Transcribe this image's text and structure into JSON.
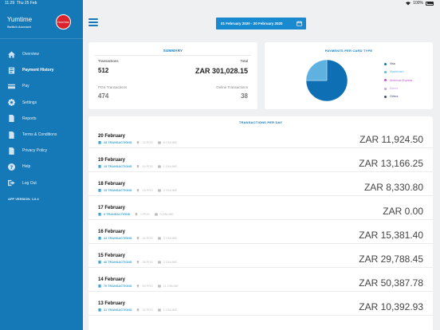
{
  "status_bar": {
    "time": "11:29",
    "date": "Thu 25 Feb",
    "battery": "100%"
  },
  "sidebar": {
    "app_name": "Yumtime",
    "switch_account": "Switch Account",
    "logo_text": "Yumtime",
    "app_version": "APP VERSION: 1.0.4",
    "items": [
      {
        "label": "Overview",
        "icon": "home-icon"
      },
      {
        "label": "Payment History",
        "icon": "history-icon",
        "active": true
      },
      {
        "label": "Pay",
        "icon": "card-icon"
      },
      {
        "label": "Settings",
        "icon": "gear-icon"
      },
      {
        "label": "Reports",
        "icon": "document-icon"
      },
      {
        "label": "Terms & Conditions",
        "icon": "document-icon"
      },
      {
        "label": "Privacy Policy",
        "icon": "document-icon"
      },
      {
        "label": "Help",
        "icon": "question-icon"
      },
      {
        "label": "Log Out",
        "icon": "logout-icon"
      }
    ]
  },
  "header": {
    "date_range": "01 February 2020 - 20 February 2020"
  },
  "summary": {
    "title": "SUMMARY",
    "transactions_label": "Transactions",
    "transactions_value": "512",
    "total_label": "Total",
    "total_value": "ZAR 301,028.15",
    "pos_label": "POS Transactions",
    "pos_value": "474",
    "online_label": "Online Transactions",
    "online_value": "38"
  },
  "payments_by_card": {
    "title": "PAYMENTS PER CARD TYPE",
    "legend": [
      {
        "label": "Visa",
        "color": "#0e6fb4"
      },
      {
        "label": "Mastercard",
        "color": "#5fb2e0"
      },
      {
        "label": "American Express",
        "color": "#c44bd3"
      },
      {
        "label": "Diners",
        "color": "#c79be0"
      },
      {
        "label": "Others",
        "color": "#3b4a6b"
      }
    ]
  },
  "chart_data": {
    "type": "pie",
    "title": "PAYMENTS PER CARD TYPE",
    "slices": [
      {
        "label": "Visa",
        "value": 75
      },
      {
        "label": "Mastercard",
        "value": 25
      },
      {
        "label": "American Express",
        "value": 0
      },
      {
        "label": "Diners",
        "value": 0
      },
      {
        "label": "Others",
        "value": 0
      }
    ]
  },
  "transactions_per_day": {
    "title": "TRANSACTIONS PER DAY",
    "rows": [
      {
        "date": "20 February",
        "transactions": "28 TRANSACTIONS",
        "pos": "22 POS",
        "online": "6 ONLINE",
        "amount": "ZAR 11,924.50"
      },
      {
        "date": "19 February",
        "transactions": "15 TRANSACTIONS",
        "pos": "14 POS",
        "online": "1 ONLINE",
        "amount": "ZAR 13,166.25"
      },
      {
        "date": "18 February",
        "transactions": "15 TRANSACTIONS",
        "pos": "15 POS",
        "online": "0 ONLINE",
        "amount": "ZAR 8,330.80"
      },
      {
        "date": "17 February",
        "transactions": "0 TRANSACTIONS",
        "pos": "0 POS",
        "online": "0 ONLINE",
        "amount": "ZAR 0.00"
      },
      {
        "date": "16 February",
        "transactions": "33 TRANSACTIONS",
        "pos": "30 POS",
        "online": "3 ONLINE",
        "amount": "ZAR 15,381.40"
      },
      {
        "date": "15 February",
        "transactions": "40 TRANSACTIONS",
        "pos": "38 POS",
        "online": "2 ONLINE",
        "amount": "ZAR 29,788.45"
      },
      {
        "date": "14 February",
        "transactions": "70 TRANSACTIONS",
        "pos": "59 POS",
        "online": "11 ONLINE",
        "amount": "ZAR 50,387.78"
      },
      {
        "date": "13 February",
        "transactions": "31 TRANSACTIONS",
        "pos": "30 POS",
        "online": "1 ONLINE",
        "amount": "ZAR 10,392.93"
      }
    ]
  }
}
